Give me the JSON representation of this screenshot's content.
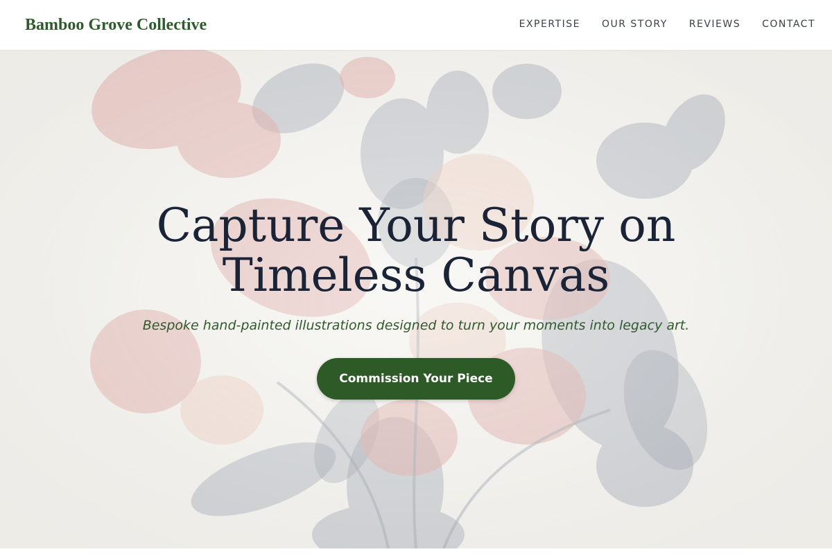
{
  "header": {
    "brand": "Bamboo Grove Collective",
    "nav": [
      "EXPERTISE",
      "OUR STORY",
      "REVIEWS",
      "CONTACT"
    ]
  },
  "hero": {
    "headline": "Capture Your Story on Timeless Canvas",
    "tagline": "Bespoke hand-painted illustrations designed to turn your moments into legacy art.",
    "cta_label": "Commission Your Piece",
    "background_image": "faded botanical floral engraving"
  },
  "colors": {
    "brand_green": "#2f5a2c",
    "button_green": "#2d5a27",
    "headline_navy": "#1b2336",
    "floral_red": "#d9a6a2",
    "floral_grey": "#a6adb6"
  }
}
